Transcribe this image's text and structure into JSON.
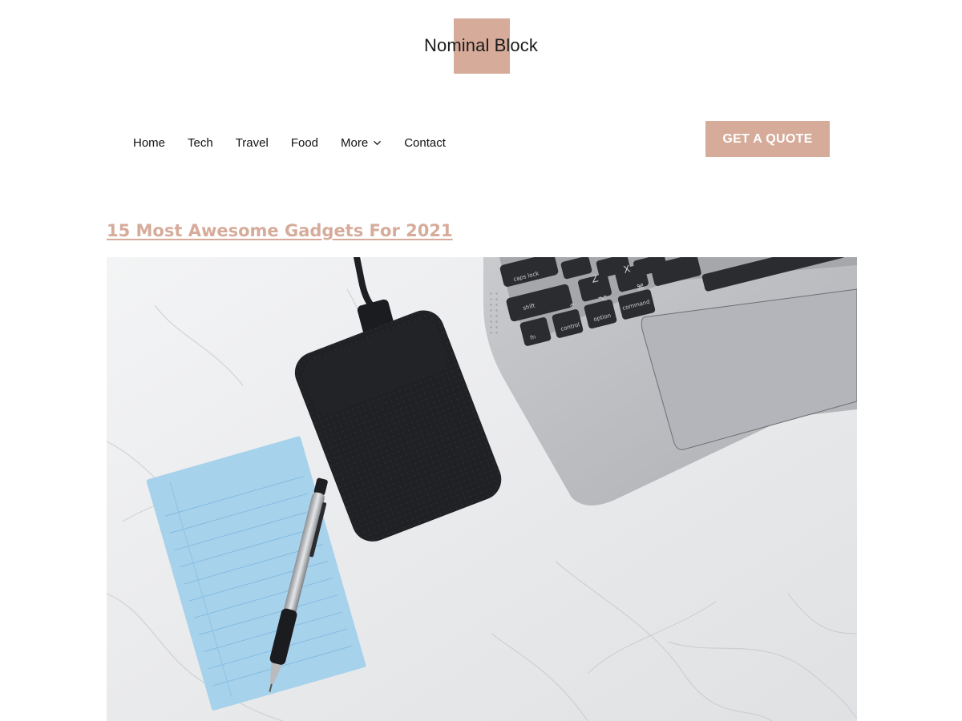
{
  "site": {
    "title": "Nominal Block",
    "accent_color": "#d6ab9a"
  },
  "nav": {
    "items": [
      {
        "label": "Home"
      },
      {
        "label": "Tech"
      },
      {
        "label": "Travel"
      },
      {
        "label": "Food"
      },
      {
        "label": "More",
        "icon": "chevron-down-icon"
      },
      {
        "label": "Contact"
      }
    ],
    "cta_label": "GET A QUOTE"
  },
  "post": {
    "title": "15 Most Awesome Gadgets For 2021",
    "image": {
      "depicts": [
        "marble-surface",
        "laptop",
        "external-hard-drive",
        "notepad",
        "pen"
      ],
      "keyboard_labels": [
        "caps lock",
        "shift",
        "fn",
        "control",
        "option",
        "command",
        "Z",
        "X",
        "⌘",
        "⌥",
        "^"
      ]
    }
  }
}
